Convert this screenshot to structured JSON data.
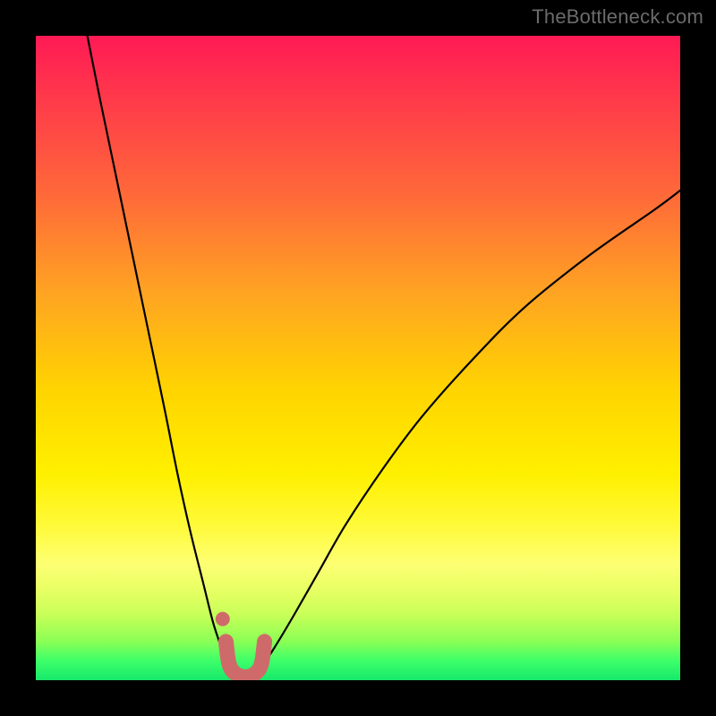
{
  "watermark": "TheBottleneck.com",
  "chart_data": {
    "type": "line",
    "title": "",
    "xlabel": "",
    "ylabel": "",
    "xlim": [
      0,
      100
    ],
    "ylim": [
      0,
      100
    ],
    "grid": false,
    "legend": false,
    "series": [
      {
        "name": "left-curve",
        "x": [
          8,
          10,
          12.5,
          15,
          17.5,
          20,
          22,
          24,
          26,
          27.5,
          28.8,
          29.8
        ],
        "values": [
          100,
          90,
          78,
          66,
          54,
          42,
          32,
          23,
          15,
          9,
          5,
          2
        ]
      },
      {
        "name": "right-curve",
        "x": [
          35,
          37,
          40,
          44,
          48,
          54,
          60,
          68,
          76,
          86,
          96,
          100
        ],
        "values": [
          2,
          5,
          10,
          17,
          24,
          33,
          41,
          50,
          58,
          66,
          73,
          76
        ]
      },
      {
        "name": "highlight-segment",
        "x": [
          29.5,
          30,
          31,
          32.5,
          34,
          35,
          35.5
        ],
        "values": [
          6,
          2.5,
          1,
          0.5,
          1,
          2.5,
          6
        ]
      }
    ],
    "markers": [
      {
        "name": "highlight-dot",
        "x": 29,
        "y": 9.5
      }
    ],
    "colors": {
      "curve": "#000000",
      "highlight": "#cf6a6a",
      "gradient_top": "#ff1a55",
      "gradient_bottom": "#17e86b"
    }
  }
}
